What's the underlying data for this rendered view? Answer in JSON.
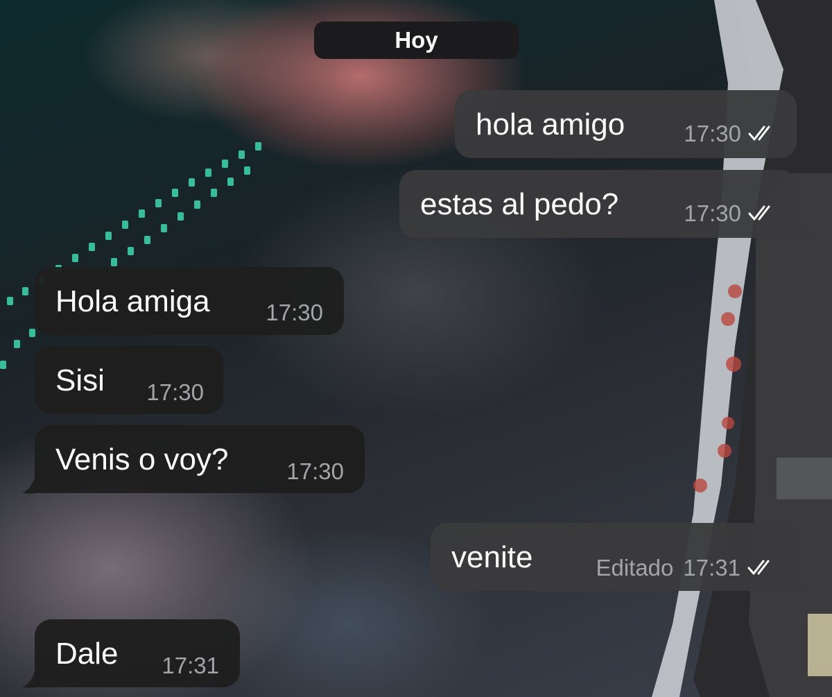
{
  "date_separator": "Hoy",
  "messages": [
    {
      "text": "hola amigo",
      "time": "17:30",
      "direction": "outgoing",
      "status_icon": "double-check-icon"
    },
    {
      "text": "estas al pedo?",
      "time": "17:30",
      "direction": "outgoing",
      "status_icon": "double-check-icon"
    },
    {
      "text": "Hola amiga",
      "time": "17:30",
      "direction": "incoming"
    },
    {
      "text": "Sisi",
      "time": "17:30",
      "direction": "incoming"
    },
    {
      "text": "Venis o voy?",
      "time": "17:30",
      "direction": "incoming"
    },
    {
      "text": "venite",
      "time": "17:31",
      "edited_label": "Editado",
      "direction": "outgoing",
      "status_icon": "double-check-icon"
    },
    {
      "text": "Dale",
      "time": "17:31",
      "direction": "incoming"
    }
  ],
  "colors": {
    "outgoing_bubble": "#3a3a3c",
    "incoming_bubble": "#1e1e1e",
    "date_pill": "#1b1b1d",
    "meta_text": "#a5a5a9",
    "message_text": "#ffffff"
  }
}
